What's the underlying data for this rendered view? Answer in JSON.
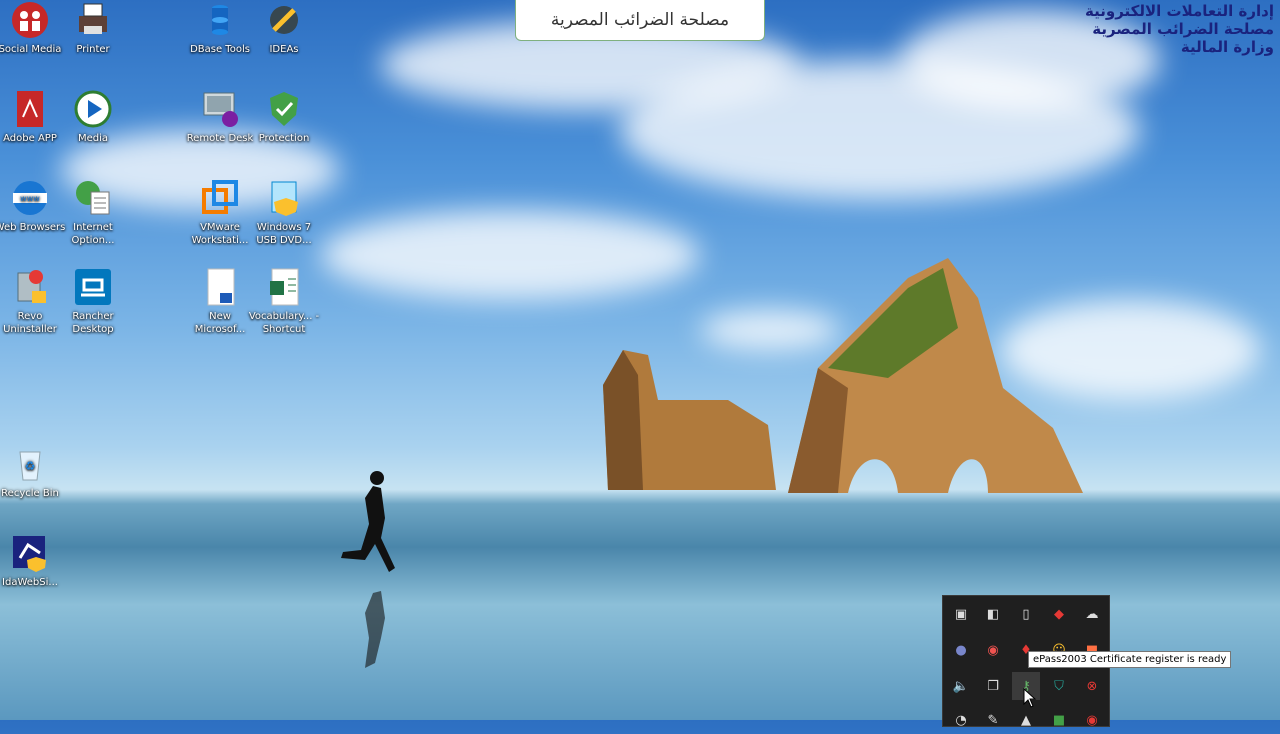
{
  "banner": {
    "text": "مصلحة الضرائب المصرية"
  },
  "logo": {
    "line1": "إدارة التعاملات الالكترونية",
    "line2": "مصلحة الضرائب المصرية",
    "line3": "وزارة المالية"
  },
  "desktop_icons": [
    {
      "label": "Social Media",
      "icon": "social-media-icon"
    },
    {
      "label": "Printer",
      "icon": "printer-icon"
    },
    {
      "label": "DBase Tools",
      "icon": "database-icon"
    },
    {
      "label": "IDEAs",
      "icon": "ideas-icon"
    },
    {
      "label": "Adobe APP",
      "icon": "adobe-pdf-icon"
    },
    {
      "label": "Media",
      "icon": "media-player-icon"
    },
    {
      "label": "Remote Desk",
      "icon": "remote-desktop-icon"
    },
    {
      "label": "Protection",
      "icon": "shield-icon"
    },
    {
      "label": "Web Browsers",
      "icon": "www-globe-icon"
    },
    {
      "label": "Internet Option...",
      "icon": "internet-options-icon"
    },
    {
      "label": "VMware Workstati...",
      "icon": "vmware-icon"
    },
    {
      "label": "Windows 7 USB DVD...",
      "icon": "usb-dvd-tool-icon"
    },
    {
      "label": "Revo Uninstaller",
      "icon": "uninstaller-icon"
    },
    {
      "label": "Rancher Desktop",
      "icon": "rancher-icon"
    },
    {
      "label": "New Microsof...",
      "icon": "word-document-icon"
    },
    {
      "label": "Vocabulary... - Shortcut",
      "icon": "excel-document-icon"
    },
    {
      "label": "Recycle Bin",
      "icon": "recycle-bin-icon"
    },
    {
      "label": "IdaWebSi...",
      "icon": "ida-web-icon"
    }
  ],
  "tray": {
    "tooltip": "ePass2003 Certificate register is ready"
  }
}
